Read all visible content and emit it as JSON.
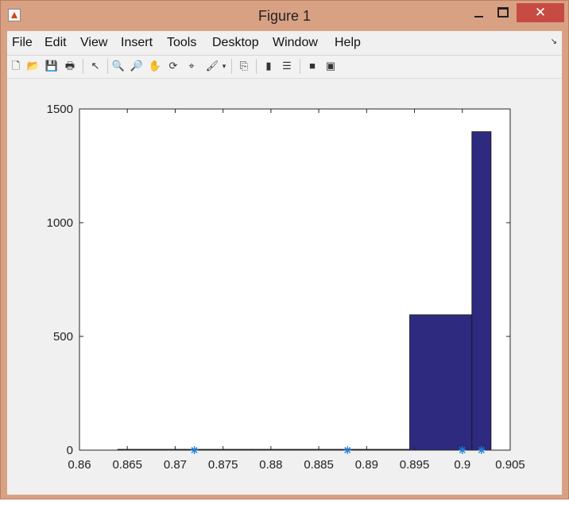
{
  "window": {
    "title": "Figure 1"
  },
  "menus": [
    "File",
    "Edit",
    "View",
    "Insert",
    "Tools",
    "Desktop",
    "Window",
    "Help"
  ],
  "toolbar_icons": [
    "new-file-icon",
    "open-folder-icon",
    "save-icon",
    "print-icon",
    "pointer-icon",
    "zoom-in-icon",
    "zoom-out-icon",
    "pan-hand-icon",
    "rotate-3d-icon",
    "data-cursor-icon",
    "brush-icon",
    "link-plot-icon",
    "colorbar-icon",
    "legend-icon",
    "hide-plot-tools-icon",
    "show-plot-tools-icon"
  ],
  "chart_data": {
    "type": "bar",
    "title": "",
    "xlabel": "",
    "ylabel": "",
    "xlim": [
      0.86,
      0.905
    ],
    "ylim": [
      0,
      1500
    ],
    "xticks": [
      "0.86",
      "0.865",
      "0.87",
      "0.875",
      "0.88",
      "0.885",
      "0.89",
      "0.895",
      "0.9",
      "0.905"
    ],
    "yticks": [
      "0",
      "500",
      "1000",
      "1500"
    ],
    "bins": [
      {
        "x0": 0.864,
        "x1": 0.871,
        "value": 0
      },
      {
        "x0": 0.871,
        "x1": 0.878,
        "value": 0
      },
      {
        "x0": 0.878,
        "x1": 0.885,
        "value": 0
      },
      {
        "x0": 0.885,
        "x1": 0.8945,
        "value": 2
      },
      {
        "x0": 0.8945,
        "x1": 0.901,
        "value": 595
      },
      {
        "x0": 0.901,
        "x1": 0.903,
        "value": 1400
      }
    ],
    "markers": [
      0.872,
      0.888,
      0.9,
      0.902
    ],
    "bar_color": "#2e2a80",
    "marker_color": "#1c7ed6"
  }
}
